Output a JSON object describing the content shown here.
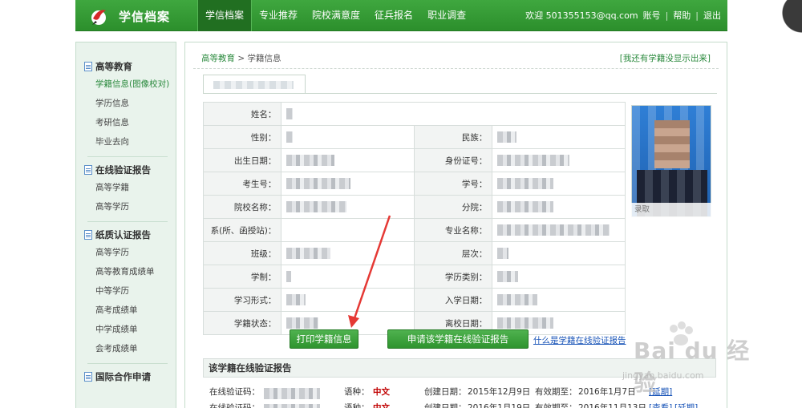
{
  "header": {
    "brand": "学信档案",
    "nav": [
      "学信档案",
      "专业推荐",
      "院校满意度",
      "征兵报名",
      "职业调查"
    ],
    "welcome": "欢迎 501355153@qq.com",
    "account": "账号",
    "help": "帮助",
    "logout": "退出",
    "separator": "|"
  },
  "sidebar": {
    "sections": [
      {
        "title": "高等教育",
        "items": [
          "学籍信息(图像校对)",
          "学历信息",
          "考研信息",
          "毕业去向"
        ]
      },
      {
        "title": "在线验证报告",
        "items": [
          "高等学籍",
          "高等学历"
        ]
      },
      {
        "title": "纸质认证报告",
        "items": [
          "高等学历",
          "高等教育成绩单",
          "中等学历",
          "高考成绩单",
          "中学成绩单",
          "会考成绩单"
        ]
      },
      {
        "title": "国际合作申请",
        "items": []
      }
    ]
  },
  "main": {
    "breadcrumb_link": "高等教育",
    "breadcrumb_sep": ">",
    "breadcrumb_current": "学籍信息",
    "not_shown_link": "[我还有学籍没显示出来]",
    "labels": {
      "name": "姓名：",
      "gender": "性别：",
      "ethnicity": "民族：",
      "birth": "出生日期：",
      "id_no": "身份证号：",
      "exam_no": "考生号：",
      "student_no": "学号：",
      "school": "院校名称：",
      "branch": "分院：",
      "department": "系(所、函授站)：",
      "major": "专业名称：",
      "class": "班级：",
      "level": "层次：",
      "duration": "学制：",
      "edu_type": "学历类别：",
      "study_form": "学习形式：",
      "enroll_date": "入学日期：",
      "status": "学籍状态：",
      "leave_date": "离校日期："
    },
    "photo_caption": "录取",
    "print_button": "打印学籍信息",
    "apply_button": "申请该学籍在线验证报告",
    "what_link": "什么是学籍在线验证报告"
  },
  "verify": {
    "title": "该学籍在线验证报告",
    "code_label": "在线验证码：",
    "lang_label": "语种：",
    "created_label": "创建日期：",
    "valid_label": "有效期至：",
    "rows": [
      {
        "lang": "中文",
        "created": "2015年12月9日",
        "valid": "2016年1月7日",
        "links": [
          "[延期]"
        ]
      },
      {
        "lang": "中文",
        "created": "2016年1月19日",
        "valid": "2016年11月13日",
        "links": [
          "[查看]",
          "[延期]"
        ]
      }
    ]
  },
  "watermark": {
    "text": "Bai du 经验",
    "sub": "jingyan.baidu.com"
  },
  "colors": {
    "brand_green": "#2c8f2c",
    "link_blue": "#1a55b8",
    "lang_red": "#c00000",
    "arrow_red": "#e53935"
  }
}
